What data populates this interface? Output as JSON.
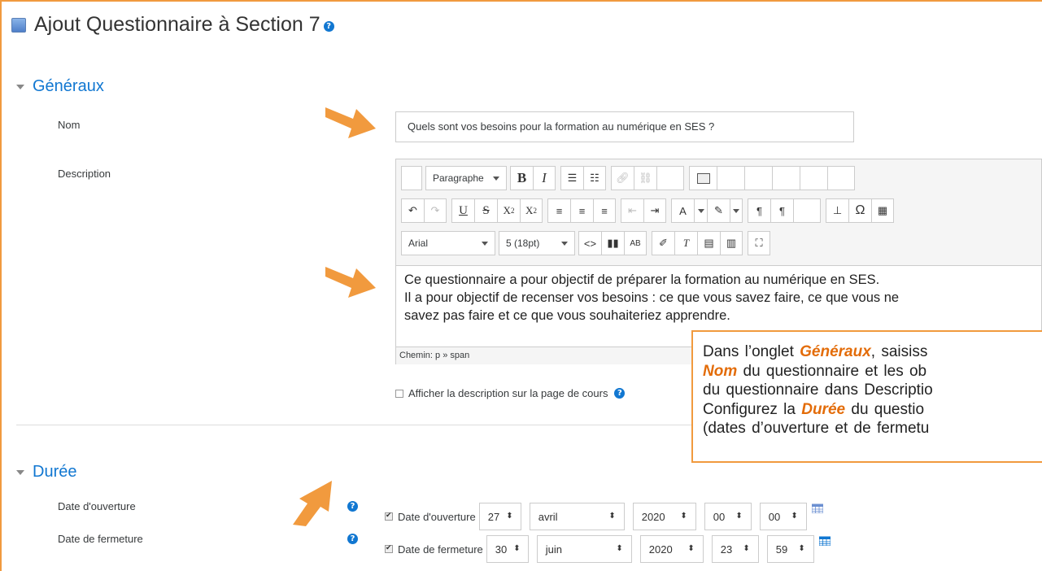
{
  "page": {
    "title": "Ajout Questionnaire à Section 7",
    "help_glyph": "?"
  },
  "sections": {
    "general": {
      "title": "Généraux"
    },
    "duration": {
      "title": "Durée"
    }
  },
  "form": {
    "name_label": "Nom",
    "name_value": "Quels sont vos besoins pour la formation au numérique en SES ?",
    "description_label": "Description",
    "show_description_label": "Afficher la description sur la page de cours",
    "open_date_label": "Date d'ouverture",
    "close_date_label": "Date de fermeture"
  },
  "editor": {
    "format_select": "Paragraphe",
    "font_select": "Arial",
    "size_select": "5 (18pt)",
    "content_lines": [
      "Ce questionnaire a pour objectif de préparer la formation au numérique en SES.",
      "Il a pour objectif de recenser vos besoins : ce que vous savez faire, ce que vous ne",
      "savez pas faire et ce que vous souhaiteriez apprendre."
    ],
    "path": "Chemin: p » span"
  },
  "open_date": {
    "checkbox_label": "Date d'ouverture",
    "checked": true,
    "day": "27",
    "month": "avril",
    "year": "2020",
    "hour": "00",
    "minute": "00"
  },
  "close_date": {
    "checkbox_label": "Date de fermeture",
    "checked": true,
    "day": "30",
    "month": "juin",
    "year": "2020",
    "hour": "23",
    "minute": "59"
  },
  "callout": {
    "line1_pre": "Dans l’onglet ",
    "line1_bold": "Généraux",
    "line1_post": ", saisiss",
    "line2_bold": "Nom",
    "line2_post": " du questionnaire et les ob",
    "line3": "du questionnaire dans Descriptio",
    "line4_pre": "Configurez la ",
    "line4_bold": "Durée",
    "line4_post": " du questio",
    "line5": "(dates d’ouverture et de fermetu"
  },
  "colors": {
    "accent": "#f19a3e",
    "link_blue": "#1177d1",
    "callout_bold": "#e36c09"
  }
}
